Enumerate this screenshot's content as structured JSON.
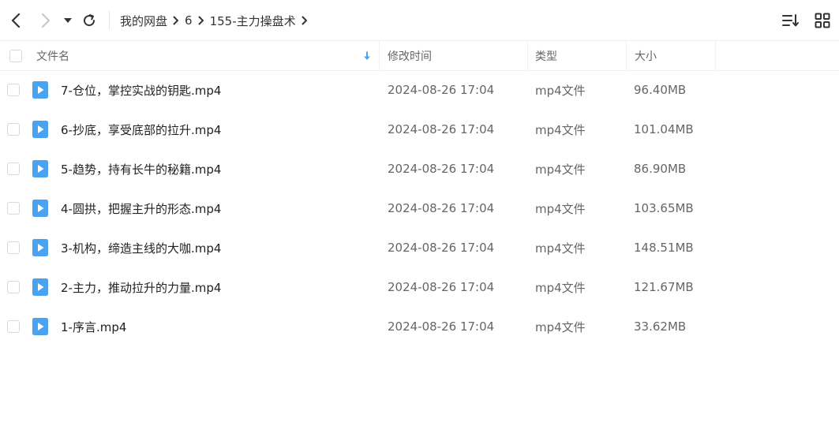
{
  "breadcrumb": {
    "items": [
      "我的网盘",
      "6",
      "155-主力操盘术"
    ]
  },
  "table": {
    "columns": [
      "文件名",
      "修改时间",
      "类型",
      "大小"
    ],
    "sort_icon": "sort-down-arrow-icon",
    "rows": [
      {
        "name": "7-仓位，掌控实战的钥匙.mp4",
        "modified": "2024-08-26 17:04",
        "type": "mp4文件",
        "size": "96.40MB"
      },
      {
        "name": "6-抄底，享受底部的拉升.mp4",
        "modified": "2024-08-26 17:04",
        "type": "mp4文件",
        "size": "101.04MB"
      },
      {
        "name": "5-趋势，持有长牛的秘籍.mp4",
        "modified": "2024-08-26 17:04",
        "type": "mp4文件",
        "size": "86.90MB"
      },
      {
        "name": "4-圆拱，把握主升的形态.mp4",
        "modified": "2024-08-26 17:04",
        "type": "mp4文件",
        "size": "103.65MB"
      },
      {
        "name": "3-机构，缔造主线的大咖.mp4",
        "modified": "2024-08-26 17:04",
        "type": "mp4文件",
        "size": "148.51MB"
      },
      {
        "name": "2-主力，推动拉升的力量.mp4",
        "modified": "2024-08-26 17:04",
        "type": "mp4文件",
        "size": "121.67MB"
      },
      {
        "name": "1-序言.mp4",
        "modified": "2024-08-26 17:04",
        "type": "mp4文件",
        "size": "33.62MB"
      }
    ]
  },
  "colors": {
    "accent": "#4aa3f0",
    "file_icon": "#4aa3f0",
    "border": "#eef0f3"
  }
}
